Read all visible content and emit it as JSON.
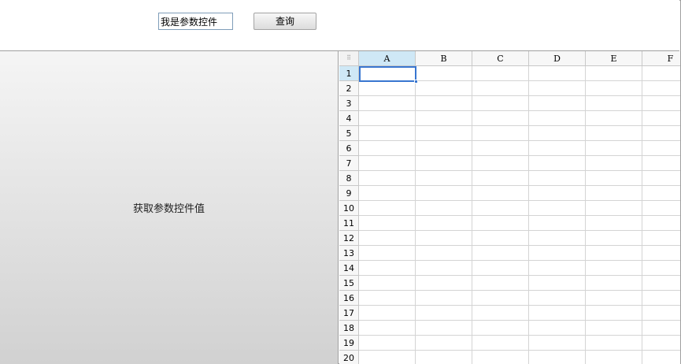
{
  "toolbar": {
    "param_value": "我是参数控件",
    "query_label": "查询"
  },
  "left_panel": {
    "button_label": "获取参数控件值"
  },
  "sheet": {
    "columns": [
      "A",
      "B",
      "C",
      "D",
      "E",
      "F"
    ],
    "rows": [
      "1",
      "2",
      "3",
      "4",
      "5",
      "6",
      "7",
      "8",
      "9",
      "10",
      "11",
      "12",
      "13",
      "14",
      "15",
      "16",
      "17",
      "18",
      "19",
      "20"
    ],
    "selected_cell": "A1",
    "header_highlight": "#cfe8f6",
    "selection_color": "#3876d0"
  }
}
